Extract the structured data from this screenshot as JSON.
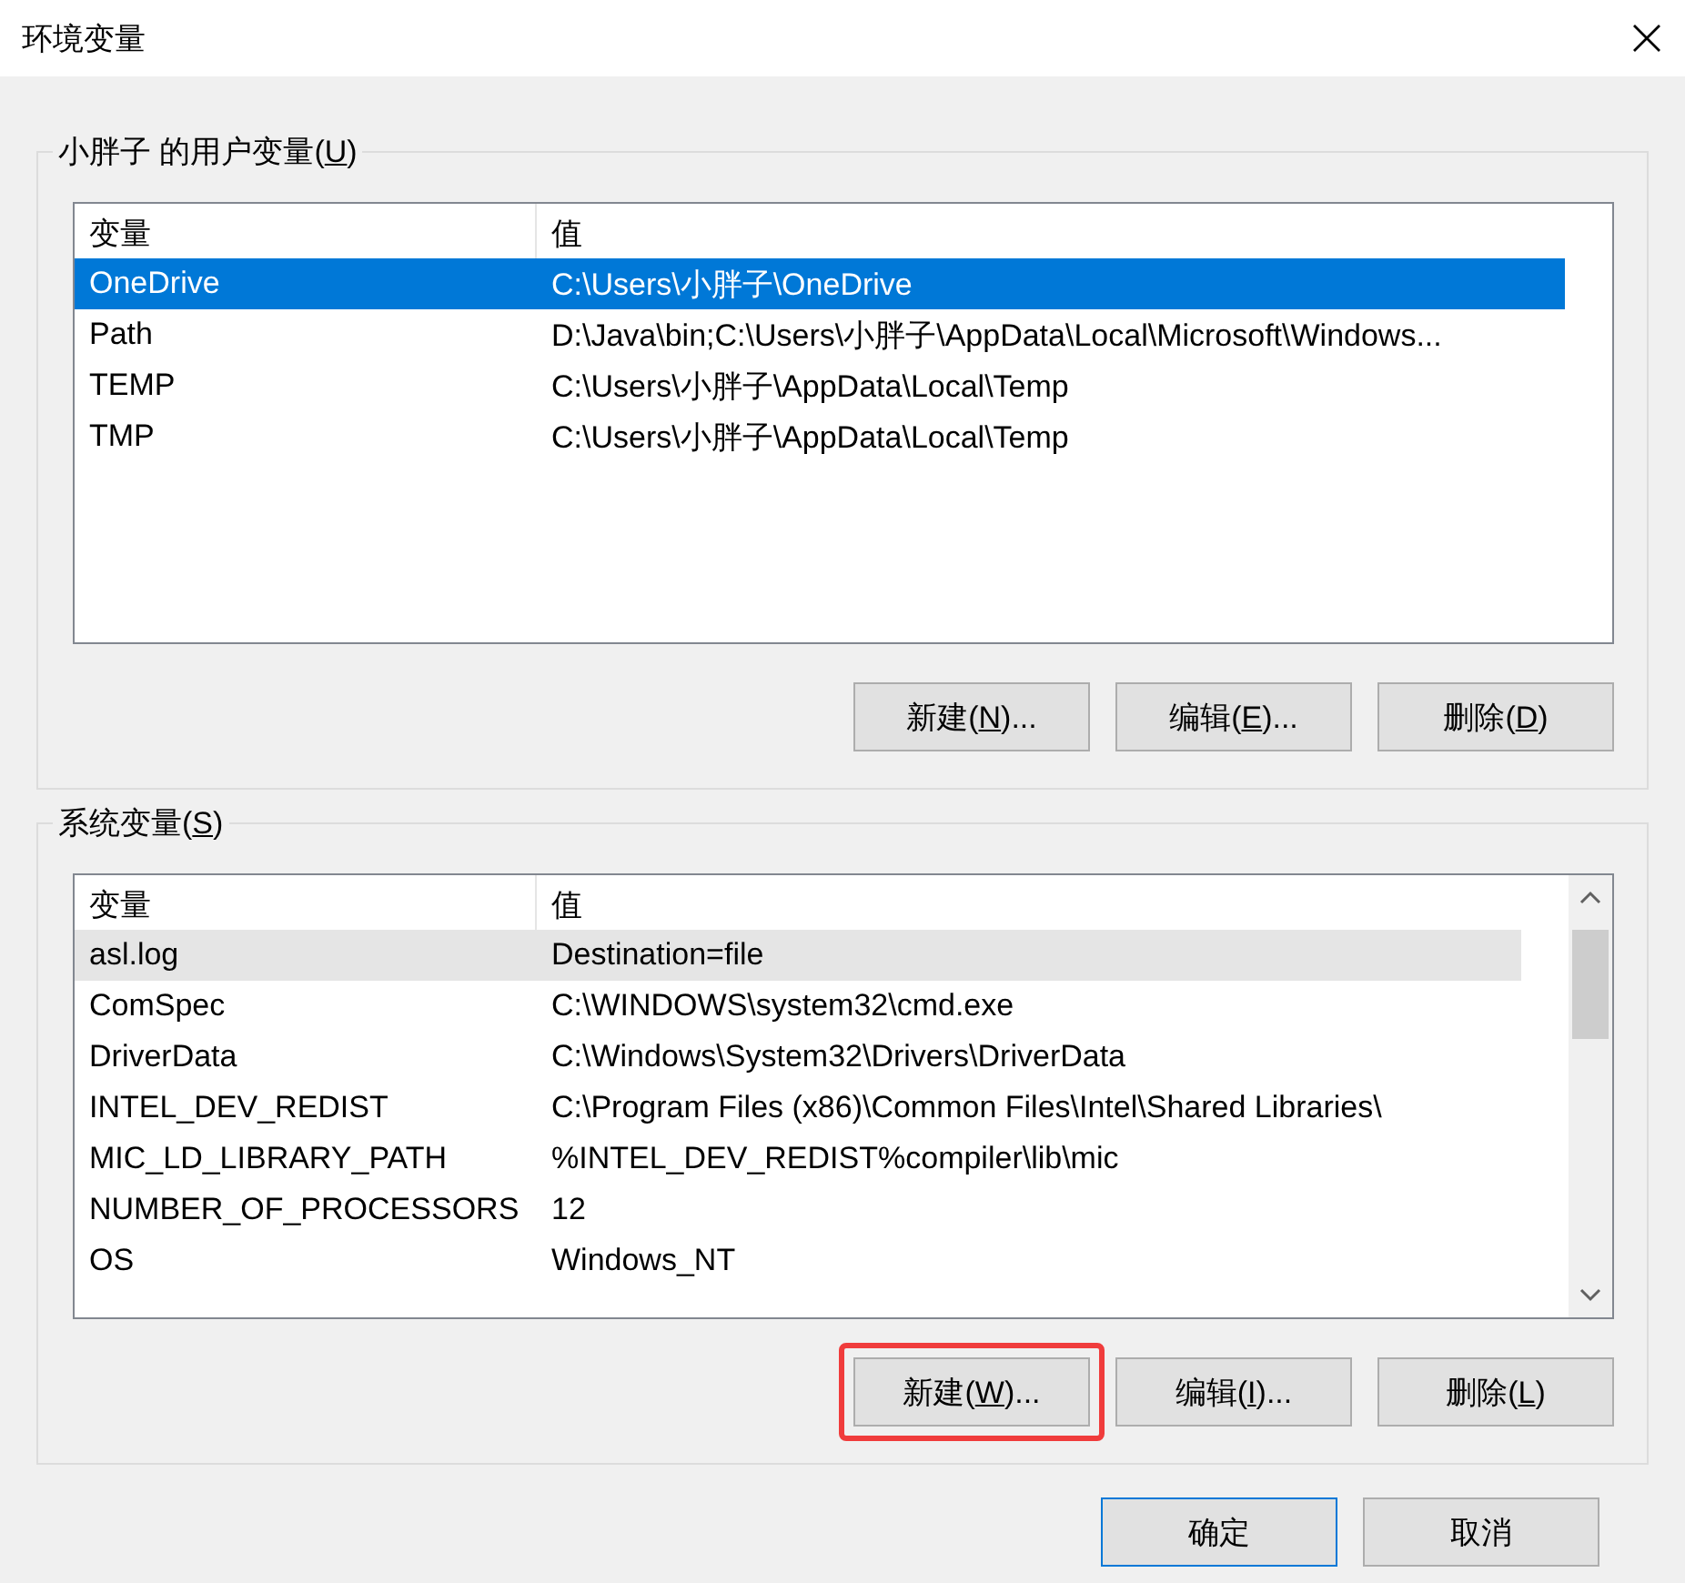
{
  "window": {
    "title": "环境变量"
  },
  "user_variables": {
    "label": {
      "before": "小胖子 的用户变量(",
      "key": "U",
      "after": ")"
    },
    "focused": true,
    "columns": [
      "变量",
      "值"
    ],
    "rows": [
      {
        "name": "OneDrive",
        "value": "C:\\Users\\小胖子\\OneDrive",
        "selected": true
      },
      {
        "name": "Path",
        "value": "D:\\Java\\bin;C:\\Users\\小胖子\\AppData\\Local\\Microsoft\\Windows...",
        "selected": false
      },
      {
        "name": "TEMP",
        "value": "C:\\Users\\小胖子\\AppData\\Local\\Temp",
        "selected": false
      },
      {
        "name": "TMP",
        "value": "C:\\Users\\小胖子\\AppData\\Local\\Temp",
        "selected": false
      }
    ],
    "buttons": [
      {
        "before": "新建(",
        "key": "N",
        "after": ")...",
        "highlighted": false
      },
      {
        "before": "编辑(",
        "key": "E",
        "after": ")...",
        "highlighted": false
      },
      {
        "before": "删除(",
        "key": "D",
        "after": ")",
        "highlighted": false
      }
    ]
  },
  "system_variables": {
    "label": {
      "before": "系统变量(",
      "key": "S",
      "after": ")"
    },
    "focused": false,
    "columns": [
      "变量",
      "值"
    ],
    "rows": [
      {
        "name": "asl.log",
        "value": "Destination=file",
        "selected": true
      },
      {
        "name": "ComSpec",
        "value": "C:\\WINDOWS\\system32\\cmd.exe",
        "selected": false
      },
      {
        "name": "DriverData",
        "value": "C:\\Windows\\System32\\Drivers\\DriverData",
        "selected": false
      },
      {
        "name": "INTEL_DEV_REDIST",
        "value": "C:\\Program Files (x86)\\Common Files\\Intel\\Shared Libraries\\",
        "selected": false
      },
      {
        "name": "MIC_LD_LIBRARY_PATH",
        "value": "%INTEL_DEV_REDIST%compiler\\lib\\mic",
        "selected": false
      },
      {
        "name": "NUMBER_OF_PROCESSORS",
        "value": "12",
        "selected": false
      },
      {
        "name": "OS",
        "value": "Windows_NT",
        "selected": false
      }
    ],
    "buttons": [
      {
        "before": "新建(",
        "key": "W",
        "after": ")...",
        "highlighted": true
      },
      {
        "before": "编辑(",
        "key": "I",
        "after": ")...",
        "highlighted": false
      },
      {
        "before": "删除(",
        "key": "L",
        "after": ")",
        "highlighted": false
      }
    ]
  },
  "footer_buttons": [
    {
      "label": "确定",
      "default": true
    },
    {
      "label": "取消",
      "default": false
    }
  ]
}
